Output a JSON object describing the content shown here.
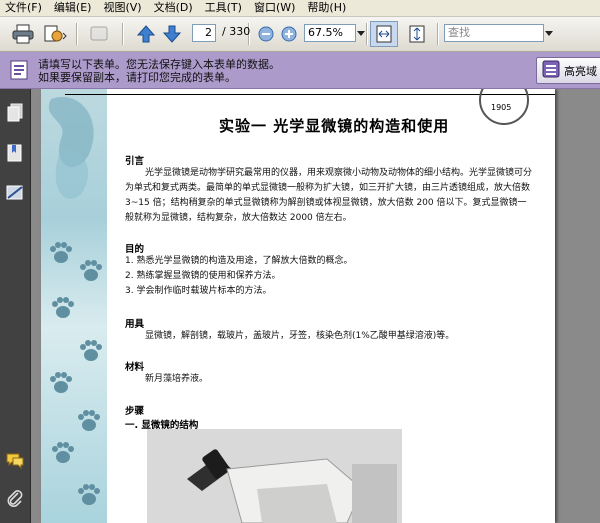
{
  "menu": [
    "文件(F)",
    "编辑(E)",
    "视图(V)",
    "文档(D)",
    "工具(T)",
    "窗口(W)",
    "帮助(H)"
  ],
  "toolbar": {
    "page_current": "2",
    "page_total": "/ 330",
    "zoom": "67.5%",
    "search_placeholder": "查找"
  },
  "formbar": {
    "line1": "请填写以下表单。您无法保存键入本表单的数据。",
    "line2": "如果要保留副本，请打印您完成的表单。",
    "highlight_label": "高亮域"
  },
  "document": {
    "title": "实验一    光学显微镜的构造和使用",
    "sections": {
      "intro_head": "引言",
      "intro_text": "光学显微镜是动物学研究最常用的仪器，用来观察微小动物及动物体的细小结构。光学显微镜可分为单式和复式两类。最简单的单式显微镜一般称为扩大镜，如三开扩大镜，由三片透镜组成，放大倍数 3~15 倍；结构稍复杂的单式显微镜称为解剖镜或体视显微镜，放大倍数 200 倍以下。复式显微镜一般就称为显微镜，结构复杂，放大倍数达 2000 倍左右。",
      "goal_head": "目的",
      "goal_1": "1. 熟悉光学显微镜的构造及用途，了解放大倍数的概念。",
      "goal_2": "2. 熟练掌握显微镜的使用和保养方法。",
      "goal_3": "3. 学会制作临时载玻片标本的方法。",
      "tools_head": "用具",
      "tools_text": "显微镜，解剖镜，载玻片，盖玻片，牙签，核染色剂(1%乙酸甲基绿溶液)等。",
      "material_head": "材料",
      "material_text": "新月藻培养液。",
      "steps_head": "步骤",
      "steps_sub": "一. 显微镜的结构",
      "seal_text": "1905"
    }
  }
}
